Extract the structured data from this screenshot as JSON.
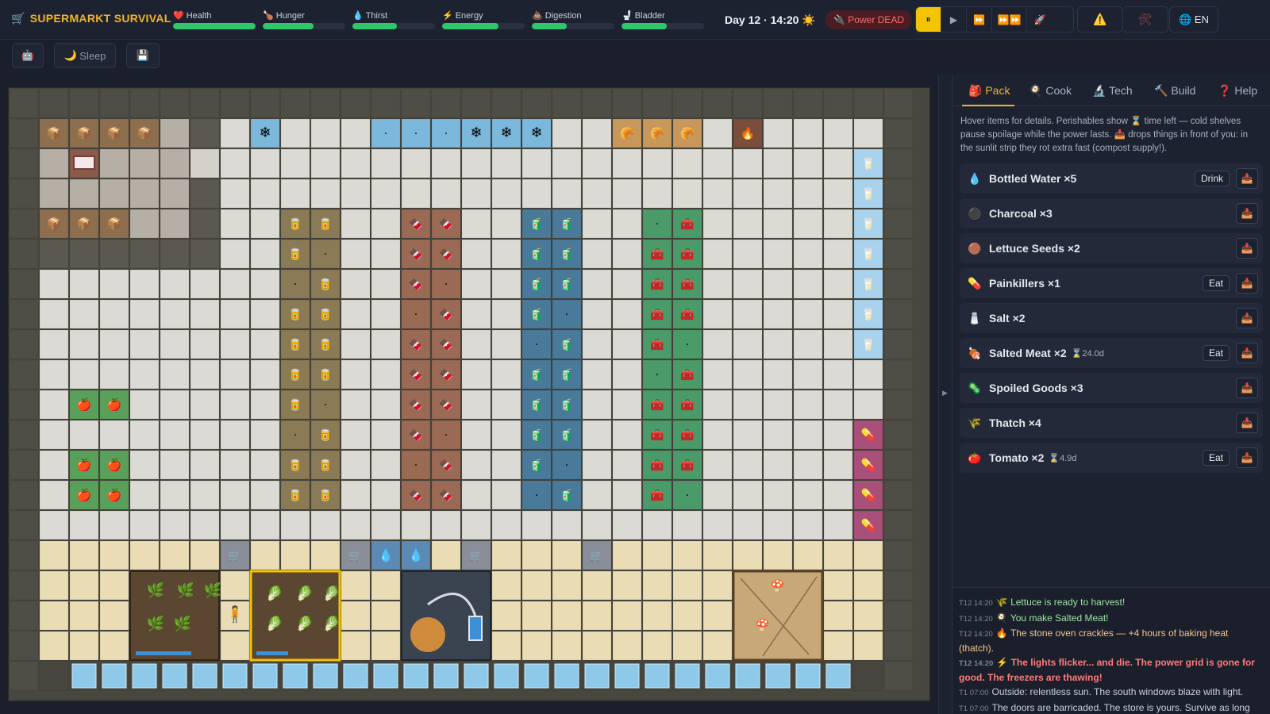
{
  "app": {
    "title": "SUPERMARKT SURVIVAL",
    "cart_icon": "shopping-cart-icon"
  },
  "stats": [
    {
      "key": "health",
      "label": "Health",
      "icon": "❤️",
      "value": 1.0,
      "color": "#2fc76a"
    },
    {
      "key": "hunger",
      "label": "Hunger",
      "icon": "🍗",
      "value": 0.62,
      "color": "#2fc76a"
    },
    {
      "key": "thirst",
      "label": "Thirst",
      "icon": "💧",
      "value": 0.54,
      "color": "#2fc76a"
    },
    {
      "key": "energy",
      "label": "Energy",
      "icon": "⚡",
      "value": 0.68,
      "color": "#2fc76a"
    },
    {
      "key": "digestion",
      "label": "Digestion",
      "icon": "💩",
      "value": 0.42,
      "color": "#2fc76a"
    },
    {
      "key": "bladder",
      "label": "Bladder",
      "icon": "🚽",
      "value": 0.55,
      "color": "#2fc76a"
    }
  ],
  "clock": {
    "day_time": "Day 12 · 14:20",
    "weather_icon": "☀️"
  },
  "power": {
    "label": "Power DEAD",
    "icon": "🔌"
  },
  "speed": {
    "pause": "⏸",
    "play": "▶",
    "fast": "⏩",
    "faster": "⏩⏩",
    "rocket": "🚀",
    "active": "pause"
  },
  "actions": {
    "warning_icon": "⚠️",
    "tools_icon": "🛠"
  },
  "language": {
    "label": "EN",
    "icon": "🌐"
  },
  "toolbar": {
    "robot_icon": "🤖",
    "sleep_label": "Sleep",
    "sleep_icon": "🌙",
    "save_icon": "💾"
  },
  "tabs": [
    {
      "label": "Pack",
      "icon": "🎒",
      "active": true
    },
    {
      "label": "Cook",
      "icon": "🍳",
      "active": false
    },
    {
      "label": "Tech",
      "icon": "🔬",
      "active": false
    },
    {
      "label": "Build",
      "icon": "🔨",
      "active": false
    },
    {
      "label": "Help",
      "icon": "❓",
      "active": false
    }
  ],
  "pack_hint": "Hover items for details. Perishables show ⌛ time left — cold shelves pause spoilage while the power lasts. 📥 drops things in front of you: in the sunlit strip they rot extra fast (compost supply!).",
  "inventory": [
    {
      "name": "Bottled Water ×5",
      "icon": "💧",
      "action": "Drink",
      "timer": ""
    },
    {
      "name": "Charcoal ×3",
      "icon": "⚫",
      "action": "",
      "timer": ""
    },
    {
      "name": "Lettuce Seeds ×2",
      "icon": "🟤",
      "action": "",
      "timer": ""
    },
    {
      "name": "Painkillers ×1",
      "icon": "💊",
      "action": "Eat",
      "timer": ""
    },
    {
      "name": "Salt ×2",
      "icon": "🧂",
      "action": "",
      "timer": ""
    },
    {
      "name": "Salted Meat ×2",
      "icon": "🍖",
      "action": "Eat",
      "timer": "⌛24.0d"
    },
    {
      "name": "Spoiled Goods ×3",
      "icon": "🦠",
      "action": "",
      "timer": ""
    },
    {
      "name": "Thatch ×4",
      "icon": "🌾",
      "action": "",
      "timer": ""
    },
    {
      "name": "Tomato ×2",
      "icon": "🍅",
      "action": "Eat",
      "timer": "⌛4.9d"
    }
  ],
  "drop_icon": "📥",
  "log": [
    {
      "time": "T12 14:20",
      "icon": "🌾",
      "text": "Lettuce is ready to harvest!",
      "tone": "good"
    },
    {
      "time": "T12 14:20",
      "icon": "🍳",
      "text": "You make Salted Meat!",
      "tone": "good"
    },
    {
      "time": "T12 14:20",
      "icon": "🔥",
      "text": "The stone oven crackles — +4 hours of baking heat (thatch).",
      "tone": "warm"
    },
    {
      "time": "T12 14:20",
      "icon": "⚡",
      "text": "The lights flicker... and die. The power grid is gone for good. The freezers are thawing!",
      "tone": "alert"
    },
    {
      "time": "T1 07:00",
      "icon": "",
      "text": "Outside: relentless sun. The south windows blaze with light.",
      "tone": "dim"
    },
    {
      "time": "T1 07:00",
      "icon": "",
      "text": "The doors are barricaded. The store is yours. Survive as long as",
      "tone": "dim"
    }
  ]
}
